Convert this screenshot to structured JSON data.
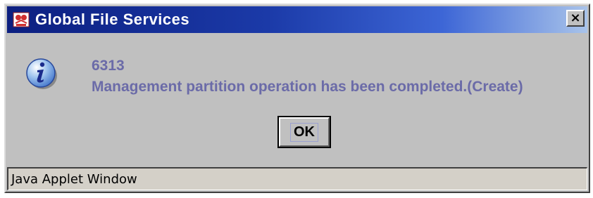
{
  "window": {
    "title": "Global File Services",
    "close_glyph": "×",
    "app_icon": "gfs-app-icon"
  },
  "dialog": {
    "icon": "information-icon",
    "code": "6313",
    "message": "Management partition operation has been completed.(Create)",
    "ok_label": "OK"
  },
  "statusbar": {
    "text": "Java Applet Window"
  },
  "colors": {
    "title_start": "#0c1f80",
    "title_end": "#a8c3ea",
    "message_text": "#6b6ba8",
    "dialog_bg": "#c0c0c0",
    "status_bg": "#d4d0c8"
  }
}
